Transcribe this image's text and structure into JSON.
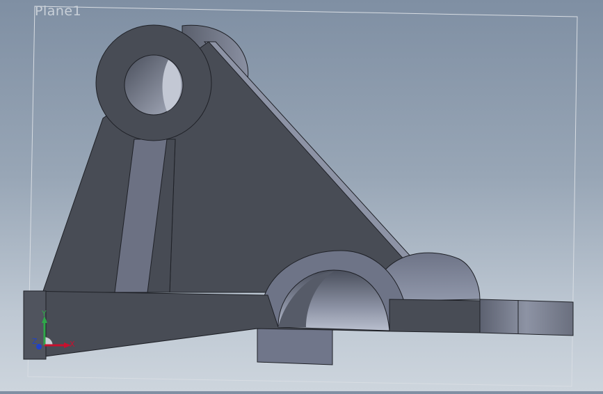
{
  "viewport": {
    "plane_label": "Plane1",
    "background_top": "#7f8fa3",
    "background_bottom": "#cdd5dd"
  },
  "triad": {
    "x_label": "X",
    "y_label": "Y",
    "z_label": "Z",
    "x_color": "#c8102e",
    "y_color": "#2fa84a",
    "z_color": "#2042c8"
  },
  "model": {
    "face_color_dark": "#474b54",
    "face_color_light": "#6b7080"
  }
}
